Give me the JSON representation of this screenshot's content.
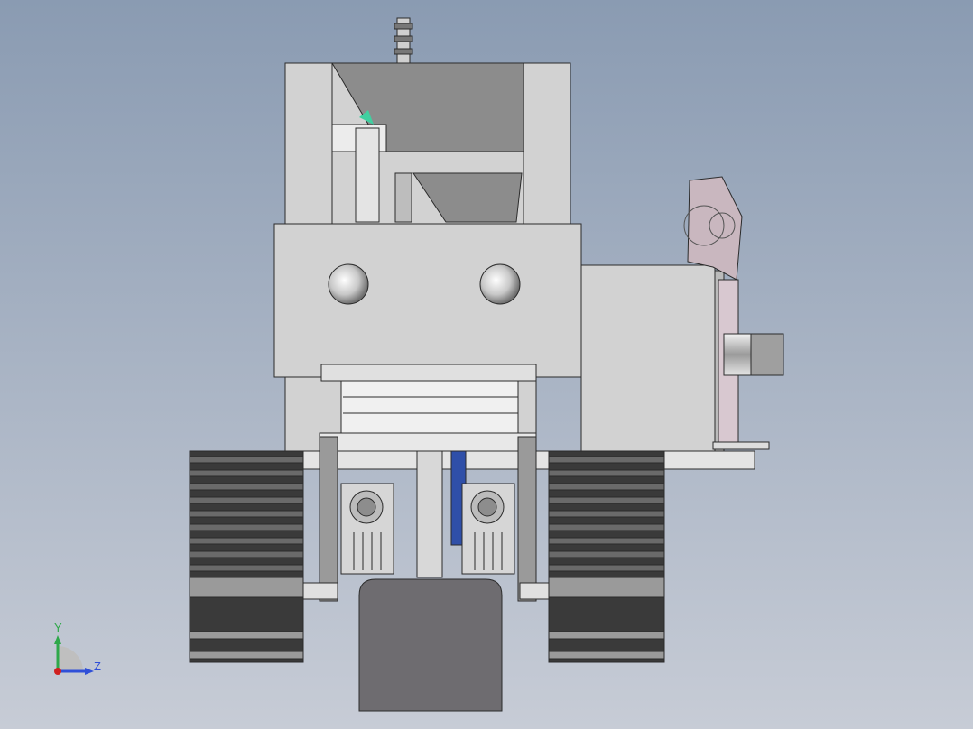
{
  "viewport": {
    "background_top": "#8a9bb2",
    "background_bottom": "#c7ccd6"
  },
  "model": {
    "body_color": "#d2d2d2",
    "dark_panel_color": "#8c8c8c",
    "track_color": "#3a3a3a",
    "track_highlight": "#6a6a6a",
    "blade_color": "#6e6c70",
    "outline_color": "#2b2b2b",
    "accent_blue": "#2f4fa8",
    "accent_green": "#3fd0a0"
  },
  "triad": {
    "y_label": "Y",
    "z_label": "Z",
    "y_color": "#2ea84a",
    "z_color": "#2f4fd8",
    "x_color": "#d02020"
  }
}
